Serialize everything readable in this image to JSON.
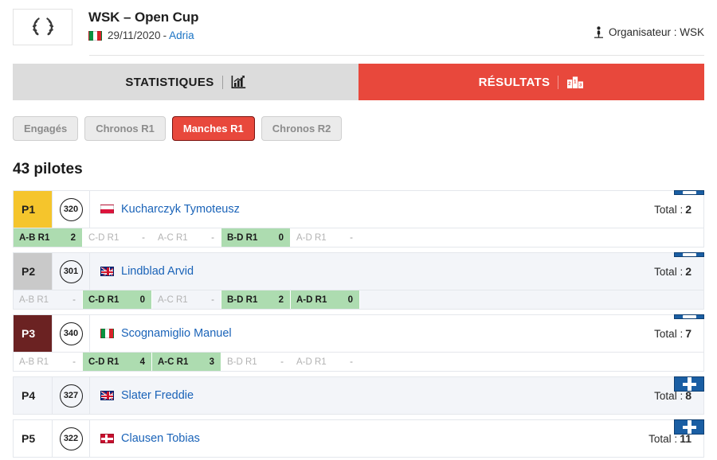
{
  "header": {
    "logo_icon": "laurel-wreath-icon",
    "title": "WSK – Open Cup",
    "country_flag": "flag-italy",
    "date": "29/11/2020",
    "separator": "-",
    "location": "Adria",
    "organiser_icon": "organiser-icon",
    "organiser": "Organisateur : WSK"
  },
  "tabs": [
    {
      "label": "STATISTIQUES",
      "icon": "chart-icon",
      "active": false
    },
    {
      "label": "RÉSULTATS",
      "icon": "podium-icon",
      "active": true
    }
  ],
  "subtabs": [
    {
      "label": "Engagés",
      "active": false
    },
    {
      "label": "Chronos R1",
      "active": false
    },
    {
      "label": "Manches R1",
      "active": true
    },
    {
      "label": "Chronos R2",
      "active": false
    }
  ],
  "pilot_count": "43 pilotes",
  "total_label": "Total :",
  "drivers": [
    {
      "position": "P1",
      "badge": "gold",
      "number": "320",
      "flag": "flag-poland",
      "name": "Kucharczyk Tymoteusz",
      "total": "2",
      "expanded": true,
      "toggle_icon": "minus-icon",
      "heats": [
        {
          "label": "A-B R1",
          "value": "2",
          "active": true
        },
        {
          "label": "C-D R1",
          "value": "-",
          "active": false
        },
        {
          "label": "A-C R1",
          "value": "-",
          "active": false
        },
        {
          "label": "B-D R1",
          "value": "0",
          "active": true
        },
        {
          "label": "A-D R1",
          "value": "-",
          "active": false
        }
      ]
    },
    {
      "position": "P2",
      "badge": "silver",
      "number": "301",
      "flag": "flag-great-britain",
      "name": "Lindblad Arvid",
      "total": "2",
      "expanded": true,
      "toggle_icon": "minus-icon",
      "heats": [
        {
          "label": "A-B R1",
          "value": "-",
          "active": false
        },
        {
          "label": "C-D R1",
          "value": "0",
          "active": true
        },
        {
          "label": "A-C R1",
          "value": "-",
          "active": false
        },
        {
          "label": "B-D R1",
          "value": "2",
          "active": true
        },
        {
          "label": "A-D R1",
          "value": "0",
          "active": true
        }
      ]
    },
    {
      "position": "P3",
      "badge": "bronze",
      "number": "340",
      "flag": "flag-italy",
      "name": "Scognamiglio Manuel",
      "total": "7",
      "expanded": true,
      "toggle_icon": "minus-icon",
      "heats": [
        {
          "label": "A-B R1",
          "value": "-",
          "active": false
        },
        {
          "label": "C-D R1",
          "value": "4",
          "active": true
        },
        {
          "label": "A-C R1",
          "value": "3",
          "active": true
        },
        {
          "label": "B-D R1",
          "value": "-",
          "active": false
        },
        {
          "label": "A-D R1",
          "value": "-",
          "active": false
        }
      ]
    },
    {
      "position": "P4",
      "badge": "plain",
      "number": "327",
      "flag": "flag-great-britain",
      "name": "Slater Freddie",
      "total": "8",
      "expanded": false,
      "toggle_icon": "plus-icon",
      "heats": []
    },
    {
      "position": "P5",
      "badge": "plain",
      "number": "322",
      "flag": "flag-denmark",
      "name": "Clausen Tobias",
      "total": "11",
      "expanded": false,
      "toggle_icon": "plus-icon",
      "heats": []
    }
  ]
}
